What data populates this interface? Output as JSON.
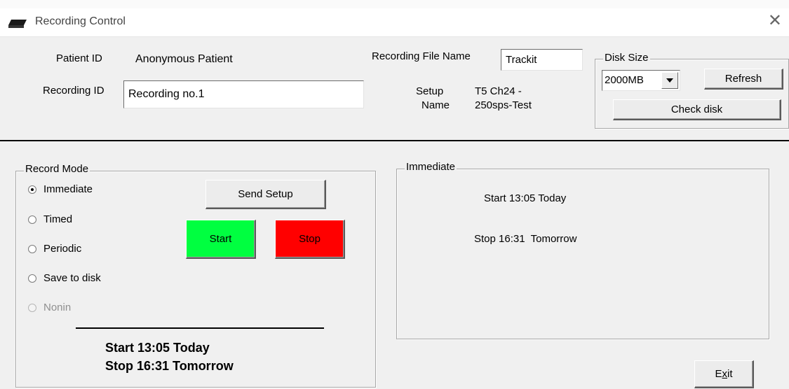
{
  "window": {
    "title": "Recording Control",
    "close_glyph": "✕",
    "icon": "recorder-device-icon"
  },
  "patient": {
    "id_label": "Patient ID",
    "id_value": "Anonymous Patient",
    "recording_id_label": "Recording ID",
    "recording_id_value": "Recording no.1"
  },
  "file": {
    "name_label": "Recording File Name",
    "name_value": "Trackit",
    "setup_label_line1": "Setup",
    "setup_label_line2": "Name",
    "setup_value_line1": "T5 Ch24 -",
    "setup_value_line2": "250sps-Test"
  },
  "disk": {
    "group_title": "Disk Size",
    "size_value": "2000MB",
    "refresh_label": "Refresh",
    "check_label": "Check disk"
  },
  "record_mode": {
    "group_title": "Record Mode",
    "options": [
      {
        "label": "Immediate",
        "checked": true,
        "disabled": false
      },
      {
        "label": "Timed",
        "checked": false,
        "disabled": false
      },
      {
        "label": "Periodic",
        "checked": false,
        "disabled": false
      },
      {
        "label": "Save to disk",
        "checked": false,
        "disabled": false
      },
      {
        "label": "Nonin",
        "checked": false,
        "disabled": true
      }
    ],
    "send_setup_label": "Send Setup",
    "start_label": "Start",
    "stop_label": "Stop",
    "start_color": "#00ff40",
    "stop_color": "#ff0000",
    "summary_start": "Start 13:05 Today",
    "summary_stop": "Stop 16:31 Tomorrow"
  },
  "immediate": {
    "group_title": "Immediate",
    "start_text": "Start 13:05 Today",
    "stop_text": "Stop 16:31  Tomorrow"
  },
  "footer": {
    "exit_label_prefix": "E",
    "exit_label_underlined": "x",
    "exit_label_suffix": "it"
  }
}
